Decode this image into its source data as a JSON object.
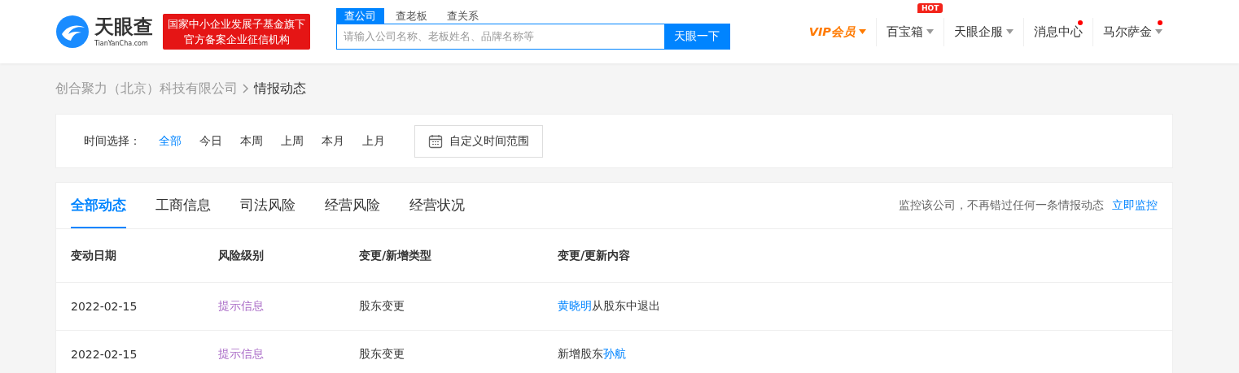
{
  "header": {
    "logo": {
      "name": "天眼查",
      "domain": "TianYanCha.com"
    },
    "banner": [
      "国家中小企业发展子基金旗下",
      "官方备案企业征信机构"
    ],
    "search": {
      "tabs": [
        {
          "label": "查公司",
          "selected": true
        },
        {
          "label": "查老板",
          "selected": false
        },
        {
          "label": "查关系",
          "selected": false
        }
      ],
      "placeholder": "请输入公司名称、老板姓名、品牌名称等",
      "button": "天眼一下"
    },
    "nav": [
      {
        "label": "VIP会员",
        "kind": "vip",
        "caret": true,
        "dot": false
      },
      {
        "label": "百宝箱",
        "kind": "plain",
        "caret": true,
        "dot": false,
        "badge": "HOT"
      },
      {
        "label": "天眼企服",
        "kind": "plain",
        "caret": true,
        "dot": false
      },
      {
        "label": "消息中心",
        "kind": "plain",
        "caret": false,
        "dot": true
      },
      {
        "label": "马尔萨金",
        "kind": "plain",
        "caret": true,
        "dot": true
      }
    ]
  },
  "breadcrumb": [
    "创合聚力（北京）科技有限公司",
    "情报动态"
  ],
  "time_filter": {
    "label": "时间选择：",
    "options": [
      {
        "label": "全部",
        "selected": true
      },
      {
        "label": "今日",
        "selected": false
      },
      {
        "label": "本周",
        "selected": false
      },
      {
        "label": "上周",
        "selected": false
      },
      {
        "label": "本月",
        "selected": false
      },
      {
        "label": "上月",
        "selected": false
      }
    ],
    "custom_range": "自定义时间范围"
  },
  "tabs": [
    {
      "label": "全部动态",
      "selected": true
    },
    {
      "label": "工商信息",
      "selected": false
    },
    {
      "label": "司法风险",
      "selected": false
    },
    {
      "label": "经营风险",
      "selected": false
    },
    {
      "label": "经营状况",
      "selected": false
    }
  ],
  "monitor": {
    "text": "监控该公司，不再错过任何一条情报动态",
    "link": "立即监控"
  },
  "table": {
    "columns": [
      "变动日期",
      "风险级别",
      "变更/新增类型",
      "变更/更新内容"
    ],
    "rows": [
      {
        "date": "2022-02-15",
        "risk": "提示信息",
        "type": "股东变更",
        "content": [
          {
            "text": "黄晓明",
            "kind": "link"
          },
          {
            "text": "从股东中退出",
            "kind": "text"
          }
        ]
      },
      {
        "date": "2022-02-15",
        "risk": "提示信息",
        "type": "股东变更",
        "content": [
          {
            "text": "新增股东",
            "kind": "text"
          },
          {
            "text": "孙航",
            "kind": "link"
          }
        ]
      }
    ]
  }
}
